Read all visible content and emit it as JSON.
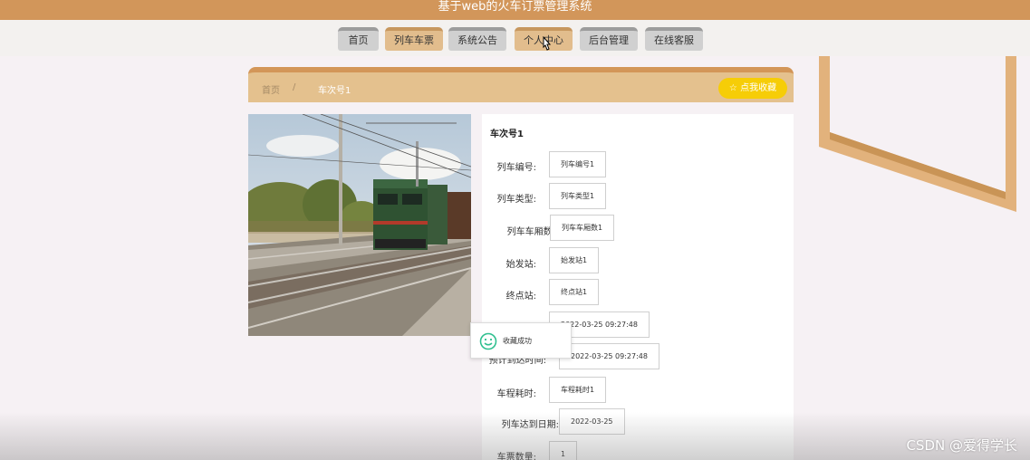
{
  "header": {
    "title": "基于web的火车订票管理系统"
  },
  "nav": {
    "items": [
      {
        "label": "首页"
      },
      {
        "label": "列车车票"
      },
      {
        "label": "系统公告"
      },
      {
        "label": "个人中心"
      },
      {
        "label": "后台管理"
      },
      {
        "label": "在线客服"
      }
    ]
  },
  "breadcrumb": {
    "home": "首页",
    "separator": "/",
    "current": "车次号1"
  },
  "favorite_button": {
    "label": "☆ 点我收藏"
  },
  "detail": {
    "title": "车次号1",
    "fields": [
      {
        "label": "列车编号:",
        "value": "列车编号1"
      },
      {
        "label": "列车类型:",
        "value": "列车类型1"
      },
      {
        "label": "列车车厢数:",
        "value": "列车车厢数1"
      },
      {
        "label": "始发站:",
        "value": "始发站1"
      },
      {
        "label": "终点站:",
        "value": "终点站1"
      },
      {
        "label": "",
        "value": "2022-03-25 09:27:48"
      },
      {
        "label": "预计到达时间:",
        "value": "2022-03-25 09:27:48"
      },
      {
        "label": "车程耗时:",
        "value": "车程耗时1"
      },
      {
        "label": "列车达到日期:",
        "value": "2022-03-25"
      },
      {
        "label": "车票数量:",
        "value": "1"
      }
    ]
  },
  "toast": {
    "text": "收藏成功",
    "icon": "smile-icon"
  },
  "watermark": "CSDN @爱得学长",
  "colors": {
    "header": "#d2965a",
    "accent": "#e2bd8d",
    "favorite": "#f6cd07",
    "toast_icon": "#2fbf8f"
  }
}
